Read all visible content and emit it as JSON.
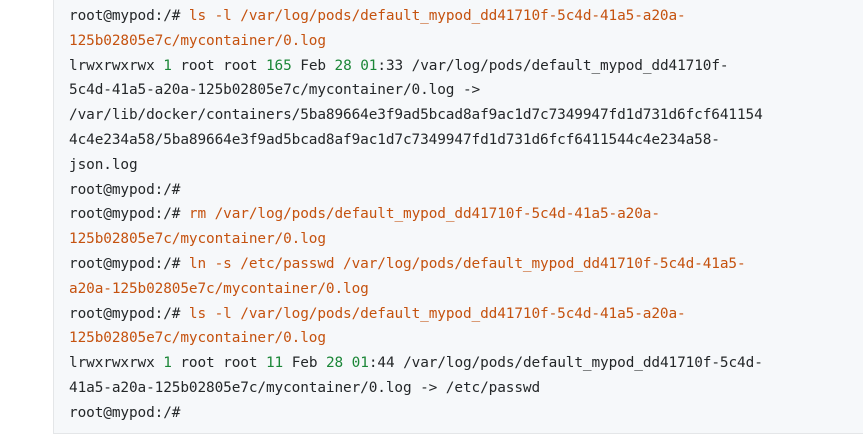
{
  "terminal": {
    "lines": [
      [
        {
          "t": "root@mypod:/# ",
          "c": ""
        },
        {
          "t": "ls -l /var/log/pods/default_mypod_dd41710f-5c4d-41a5-a20a-",
          "c": "str"
        }
      ],
      [
        {
          "t": "125b02805e7c/mycontainer/0.log",
          "c": "str"
        }
      ],
      [
        {
          "t": "lrwxrwxrwx ",
          "c": ""
        },
        {
          "t": "1",
          "c": "num"
        },
        {
          "t": " root root ",
          "c": ""
        },
        {
          "t": "165",
          "c": "num"
        },
        {
          "t": " Feb ",
          "c": ""
        },
        {
          "t": "28",
          "c": "num"
        },
        {
          "t": " ",
          "c": ""
        },
        {
          "t": "01",
          "c": "num"
        },
        {
          "t": ":33 /var/log/pods/default_mypod_dd41710f-",
          "c": ""
        }
      ],
      [
        {
          "t": "5c4d-41a5-a20a-125b02805e7c/mycontainer/0.log ->",
          "c": ""
        }
      ],
      [
        {
          "t": "/var/lib/docker/containers/5ba89664e3f9ad5bcad8af9ac1d7c7349947fd1d731d6fcf641154",
          "c": ""
        }
      ],
      [
        {
          "t": "4c4e234a58/5ba89664e3f9ad5bcad8af9ac1d7c7349947fd1d731d6fcf6411544c4e234a58-",
          "c": ""
        }
      ],
      [
        {
          "t": "json.log",
          "c": ""
        }
      ],
      [
        {
          "t": "root@mypod:/#",
          "c": ""
        }
      ],
      [
        {
          "t": "root@mypod:/# ",
          "c": ""
        },
        {
          "t": "rm /var/log/pods/default_mypod_dd41710f-5c4d-41a5-a20a-",
          "c": "str"
        }
      ],
      [
        {
          "t": "125b02805e7c/mycontainer/0.log",
          "c": "str"
        }
      ],
      [
        {
          "t": "root@mypod:/# ",
          "c": ""
        },
        {
          "t": "ln -s /etc/passwd /var/log/pods/default_mypod_dd41710f-5c4d-41a5-",
          "c": "str"
        }
      ],
      [
        {
          "t": "a20a-125b02805e7c/mycontainer/0.log",
          "c": "str"
        }
      ],
      [
        {
          "t": "root@mypod:/# ",
          "c": ""
        },
        {
          "t": "ls -l /var/log/pods/default_mypod_dd41710f-5c4d-41a5-a20a-",
          "c": "str"
        }
      ],
      [
        {
          "t": "125b02805e7c/mycontainer/0.log",
          "c": "str"
        }
      ],
      [
        {
          "t": "lrwxrwxrwx ",
          "c": ""
        },
        {
          "t": "1",
          "c": "num"
        },
        {
          "t": " root root ",
          "c": ""
        },
        {
          "t": "11",
          "c": "num"
        },
        {
          "t": " Feb ",
          "c": ""
        },
        {
          "t": "28",
          "c": "num"
        },
        {
          "t": " ",
          "c": ""
        },
        {
          "t": "01",
          "c": "num"
        },
        {
          "t": ":44 /var/log/pods/default_mypod_dd41710f-5c4d-",
          "c": ""
        }
      ],
      [
        {
          "t": "41a5-a20a-125b02805e7c/mycontainer/0.log -> /etc/passwd",
          "c": ""
        }
      ],
      [
        {
          "t": "root@mypod:/#",
          "c": ""
        }
      ]
    ]
  },
  "colors": {
    "background": "#f6f8fa",
    "text": "#242729",
    "string": "#c5520f",
    "number": "#1b8637"
  }
}
